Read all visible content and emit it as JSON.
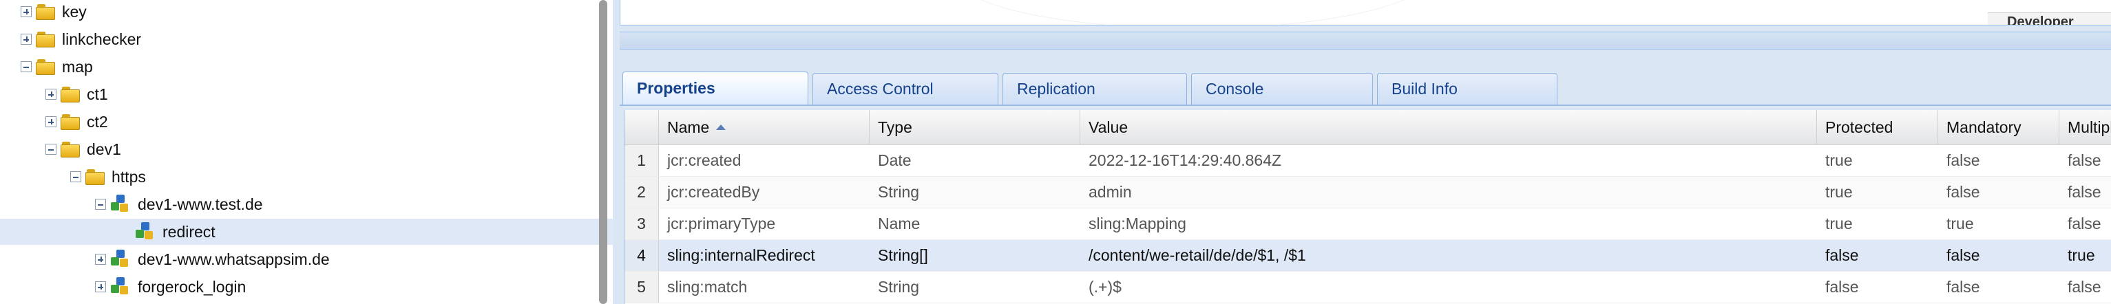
{
  "tree": {
    "nodes": [
      {
        "label": "key",
        "expander": "plus",
        "icon": "folder-icon",
        "depth": 0
      },
      {
        "label": "linkchecker",
        "expander": "plus",
        "icon": "folder-icon",
        "depth": 0
      },
      {
        "label": "map",
        "expander": "minus",
        "icon": "folder-icon",
        "depth": 0
      },
      {
        "label": "ct1",
        "expander": "plus",
        "icon": "folder-icon",
        "depth": 1
      },
      {
        "label": "ct2",
        "expander": "plus",
        "icon": "folder-icon",
        "depth": 1
      },
      {
        "label": "dev1",
        "expander": "minus",
        "icon": "folder-icon",
        "depth": 1
      },
      {
        "label": "https",
        "expander": "minus",
        "icon": "folder-icon",
        "depth": 2
      },
      {
        "label": "dev1-www.test.de",
        "expander": "minus",
        "icon": "node-icon",
        "depth": 3
      },
      {
        "label": "redirect",
        "expander": "none",
        "icon": "node-icon",
        "depth": 4,
        "selected": true
      },
      {
        "label": "dev1-www.whatsappsim.de",
        "expander": "plus",
        "icon": "node-icon",
        "depth": 3
      },
      {
        "label": "forgerock_login",
        "expander": "plus",
        "icon": "node-icon",
        "depth": 3
      }
    ]
  },
  "top_panel": {
    "dev_tab_label": "Developer"
  },
  "tabs": [
    {
      "label": "Properties",
      "active": true
    },
    {
      "label": "Access Control",
      "active": false
    },
    {
      "label": "Replication",
      "active": false
    },
    {
      "label": "Console",
      "active": false
    },
    {
      "label": "Build Info",
      "active": false
    }
  ],
  "grid": {
    "columns": [
      "Name",
      "Type",
      "Value",
      "Protected",
      "Mandatory",
      "Multiple"
    ],
    "sorted_column": "Name",
    "sort_direction": "ascending",
    "rows": [
      {
        "num": "1",
        "name": "jcr:created",
        "type": "Date",
        "value": "2022-12-16T14:29:40.864Z",
        "protected": "true",
        "mandatory": "false",
        "multiple": "false"
      },
      {
        "num": "2",
        "name": "jcr:createdBy",
        "type": "String",
        "value": "admin",
        "protected": "true",
        "mandatory": "false",
        "multiple": "false"
      },
      {
        "num": "3",
        "name": "jcr:primaryType",
        "type": "Name",
        "value": "sling:Mapping",
        "protected": "true",
        "mandatory": "true",
        "multiple": "false"
      },
      {
        "num": "4",
        "name": "sling:internalRedirect",
        "type": "String[]",
        "value": "/content/we-retail/de/de/$1, /$1",
        "protected": "false",
        "mandatory": "false",
        "multiple": "true",
        "selected": true
      },
      {
        "num": "5",
        "name": "sling:match",
        "type": "String",
        "value": "(.+)$",
        "protected": "false",
        "mandatory": "false",
        "multiple": "false"
      }
    ]
  }
}
